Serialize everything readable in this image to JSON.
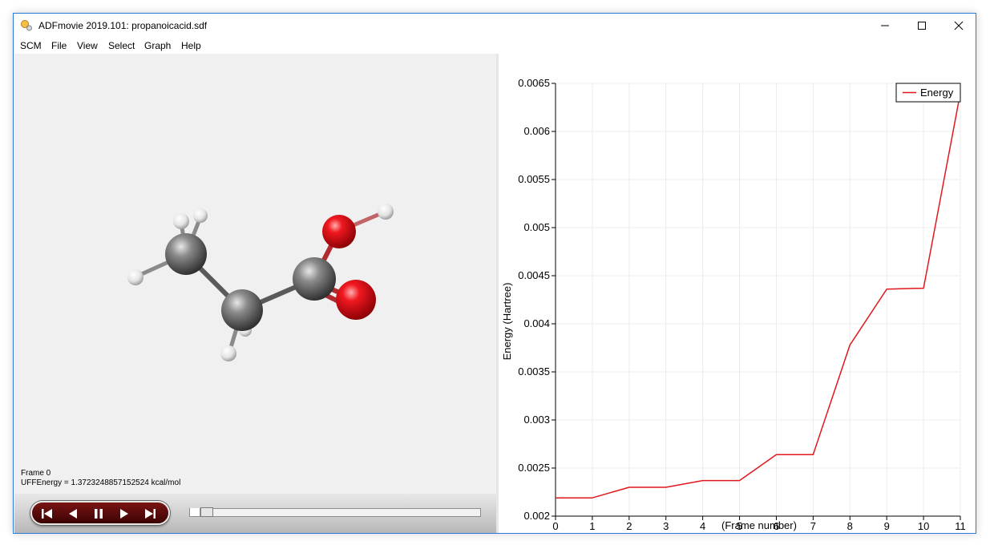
{
  "window": {
    "title": "ADFmovie 2019.101: propanoicacid.sdf"
  },
  "menu": {
    "items": [
      "SCM",
      "File",
      "View",
      "Select",
      "Graph",
      "Help"
    ]
  },
  "viewer": {
    "frame_label": "Frame 0",
    "energy_label": "UFFEnergy = 1.3723248857152524 kcal/mol"
  },
  "playback": {
    "buttons": [
      "skip-to-start-icon",
      "play-backward-icon",
      "pause-icon",
      "play-forward-icon",
      "skip-to-end-icon"
    ],
    "slider_fraction": 0.0
  },
  "colors": {
    "series": "#e0181c",
    "carbon": "#5a5a5a",
    "oxygen": "#e8101a",
    "hydrogen": "#f4f4f4",
    "transport_bg": "#5a0808"
  },
  "chart_data": {
    "type": "line",
    "xlabel": "(Frame number)",
    "ylabel": "Energy (Hartree)",
    "xlim": [
      0,
      11
    ],
    "ylim": [
      0.002,
      0.0065
    ],
    "x_ticks": [
      "0",
      "1",
      "2",
      "3",
      "4",
      "5",
      "6",
      "7",
      "8",
      "9",
      "10",
      "11"
    ],
    "y_ticks": [
      "0.002",
      "0.0025",
      "0.003",
      "0.0035",
      "0.004",
      "0.0045",
      "0.005",
      "0.0055",
      "0.006",
      "0.0065"
    ],
    "grid": true,
    "legend": "top-right",
    "series": [
      {
        "name": "Energy",
        "x": [
          0,
          1,
          2,
          3,
          4,
          5,
          6,
          7,
          8,
          9,
          10,
          11
        ],
        "y": [
          0.00219,
          0.00219,
          0.0023,
          0.0023,
          0.00237,
          0.00237,
          0.00264,
          0.00264,
          0.00378,
          0.00436,
          0.00437,
          0.0064
        ]
      }
    ]
  }
}
